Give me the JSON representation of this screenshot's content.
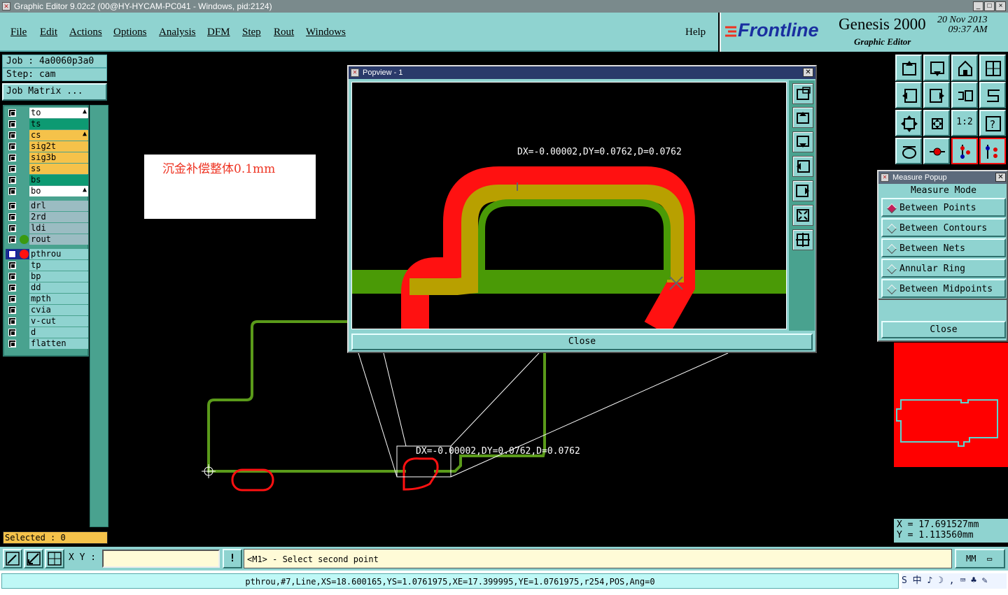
{
  "window": {
    "title": "Graphic Editor 9.02c2 (00@HY-HYCAM-PC041 - Windows, pid:2124)",
    "controls": [
      "_",
      "□",
      "×"
    ]
  },
  "menu": [
    "File",
    "Edit",
    "Actions",
    "Options",
    "Analysis",
    "DFM",
    "Step",
    "Rout",
    "Windows"
  ],
  "help": "Help",
  "brand": {
    "company": "Frontline",
    "product": "Genesis 2000",
    "subtitle": "Graphic Editor",
    "date": "20 Nov 2013",
    "time": "09:37 AM"
  },
  "job": {
    "job": "Job : 4a0060p3a0",
    "step": "Step: cam",
    "matrix_button": "Job Matrix ..."
  },
  "layers": [
    {
      "name": "to",
      "color": "#ffffff",
      "mark": true
    },
    {
      "name": "ts",
      "color": "#0d9a72",
      "mark": false
    },
    {
      "name": "cs",
      "color": "#f5c24a",
      "mark": true
    },
    {
      "name": "sig2t",
      "color": "#f5c24a",
      "mark": false
    },
    {
      "name": "sig3b",
      "color": "#f5c24a",
      "mark": false
    },
    {
      "name": "ss",
      "color": "#f5c24a",
      "mark": false
    },
    {
      "name": "bs",
      "color": "#0d9a72",
      "mark": false
    },
    {
      "name": "bo",
      "color": "#ffffff",
      "mark": true
    },
    {
      "name": "drl",
      "color": "#9bbcc2",
      "mark": false
    },
    {
      "name": "2rd",
      "color": "#9bbcc2",
      "mark": false
    },
    {
      "name": "ldi",
      "color": "#9bbcc2",
      "mark": false
    },
    {
      "name": "rout",
      "color": "#9bbcc2",
      "mark": false
    },
    {
      "name": "pthrou",
      "color": "#8fd3d0",
      "mark": false
    },
    {
      "name": "tp",
      "color": "#8fd3d0",
      "mark": false
    },
    {
      "name": "bp",
      "color": "#8fd3d0",
      "mark": false
    },
    {
      "name": "dd",
      "color": "#8fd3d0",
      "mark": false
    },
    {
      "name": "mpth",
      "color": "#8fd3d0",
      "mark": false
    },
    {
      "name": "cvia",
      "color": "#8fd3d0",
      "mark": false
    },
    {
      "name": "v-cut",
      "color": "#8fd3d0",
      "mark": false
    },
    {
      "name": "d",
      "color": "#8fd3d0",
      "mark": false
    },
    {
      "name": "flatten",
      "color": "#8fd3d0",
      "mark": false
    }
  ],
  "selected": "Selected : 0",
  "note": "沉金补偿整体0.1mm",
  "main_measure": "DX=-0.00002,DY=0.0762,D=0.0762",
  "popview": {
    "title": "Popview - 1",
    "measure": "DX=-0.00002,DY=0.0762,D=0.0762",
    "close": "Close"
  },
  "measure_popup": {
    "title": "Measure Popup",
    "mode_title": "Measure Mode",
    "modes": [
      "Between Points",
      "Between Contours",
      "Between Nets",
      "Annular Ring",
      "Between Midpoints"
    ],
    "active": 0,
    "close": "Close"
  },
  "coords": {
    "x": "X  =  17.691527mm",
    "y": "Y  =  1.113560mm"
  },
  "bottom": {
    "xy_label": "X Y :",
    "xy_value": "",
    "warn": "!",
    "prompt": "<M1> - Select second point",
    "units": "MM"
  },
  "status": "pthrou,#7,Line,XS=18.600165,YS=1.0761975,XE=17.399995,YE=1.0761975,r254,POS,Ang=0",
  "tray": "S 中 ♪ ☽ , ⌨ ♣ ✎"
}
